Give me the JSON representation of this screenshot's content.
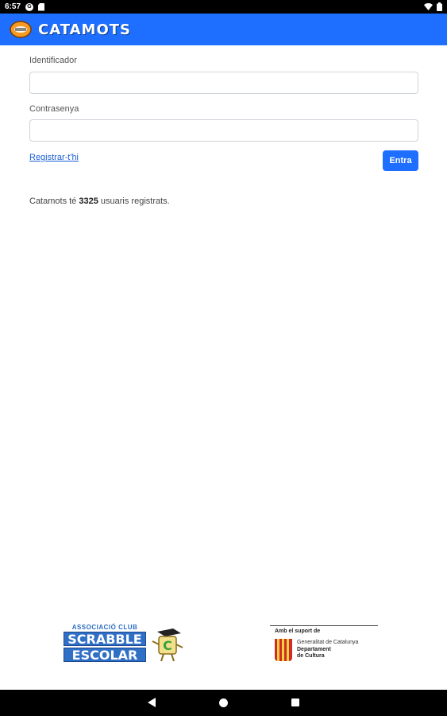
{
  "status_bar": {
    "time": "6:57"
  },
  "app_bar": {
    "title": "CATAMOTS"
  },
  "form": {
    "username_label": "Identificador",
    "username_value": "",
    "password_label": "Contrasenya",
    "password_value": "",
    "register_link": "Registrar-t'hi",
    "submit_label": "Entra"
  },
  "stats": {
    "prefix": "Catamots té ",
    "user_count": "3325",
    "suffix": " usuaris registrats."
  },
  "footer": {
    "scrabble_subtitle": "ASSOCIACIÓ CLUB",
    "scrabble_word1": "SCRABBLE",
    "scrabble_word2": "ESCOLAR",
    "support_text": "Amb el suport de",
    "gov_name": "Generalitat de Catalunya",
    "department_line1": "Departament",
    "department_line2": "de Cultura"
  },
  "colors": {
    "primary": "#1e6eff",
    "link": "#1a5fd6"
  },
  "icons": [
    "google-icon",
    "sd-card-icon",
    "wifi-icon",
    "battery-icon",
    "back-icon",
    "home-icon",
    "recents-icon"
  ]
}
